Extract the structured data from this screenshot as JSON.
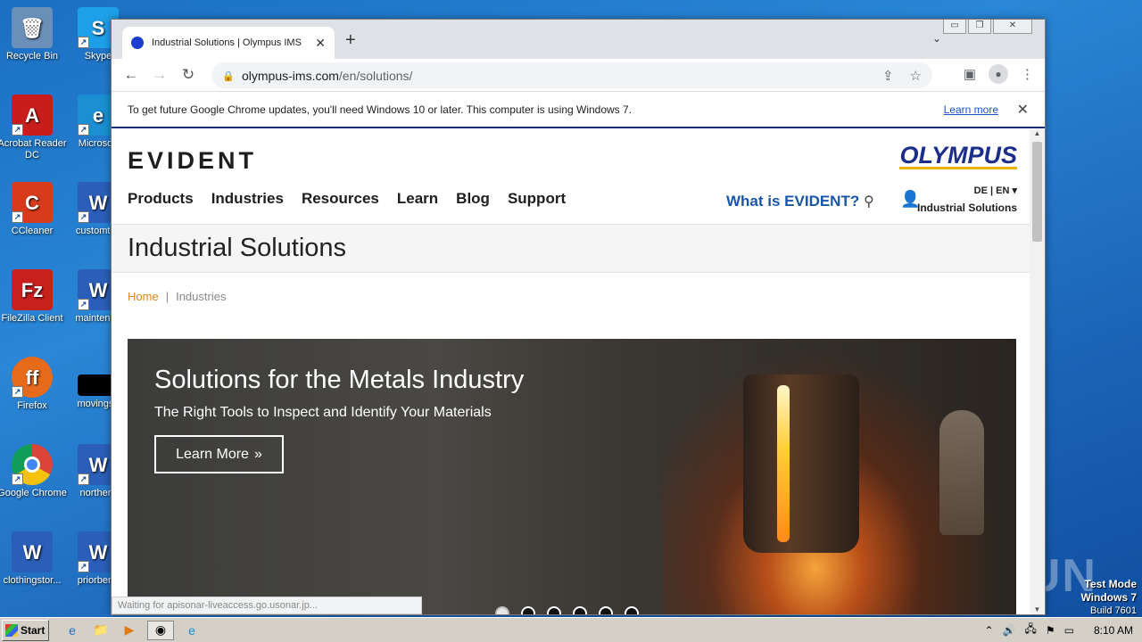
{
  "desktop": {
    "icons": [
      {
        "label": "Recycle Bin",
        "glyph": "🗑",
        "color": "#6a8fb8"
      },
      {
        "label": "Skype",
        "glyph": "S",
        "color": "#1ea0e8"
      },
      {
        "label": "Acrobat Reader DC",
        "glyph": "A",
        "color": "#c91d1d"
      },
      {
        "label": "Microsoft",
        "glyph": "e",
        "color": "#1b8fd1"
      },
      {
        "label": "CCleaner",
        "glyph": "C",
        "color": "#d83b1b"
      },
      {
        "label": "customtes",
        "glyph": "W",
        "color": "#2b5eb8"
      },
      {
        "label": "FileZilla Client",
        "glyph": "Fz",
        "color": "#c8201c"
      },
      {
        "label": "maintenan",
        "glyph": "W",
        "color": "#2b5eb8"
      },
      {
        "label": "Firefox",
        "glyph": "ff",
        "color": "#e66a1a"
      },
      {
        "label": "movingsu",
        "glyph": "",
        "color": "#000000"
      },
      {
        "label": "Google Chrome",
        "glyph": "◉",
        "color": "#2e9b3f"
      },
      {
        "label": "northern",
        "glyph": "W",
        "color": "#2b5eb8"
      },
      {
        "label": "clothingstor...",
        "glyph": "W",
        "color": "#2b5eb8"
      },
      {
        "label": "priorbene",
        "glyph": "W",
        "color": "#2b5eb8"
      }
    ],
    "watermark": "ANY ▷ RUN",
    "test_mode": {
      "line1": "Test Mode",
      "line2": "Windows 7",
      "line3": "Build 7601"
    }
  },
  "browser": {
    "tab_title": "Industrial Solutions | Olympus IMS",
    "tab_close": "✕",
    "new_tab": "+",
    "tab_dropdown": "⌄",
    "window_controls": {
      "minimize": "▭",
      "restore": "❐",
      "close": "✕"
    },
    "url_host": "olympus-ims.com",
    "url_path": "/en/solutions/",
    "info_message": "To get future Google Chrome updates, you'll need Windows 10 or later. This computer is using Windows 7.",
    "info_link": "Learn more",
    "info_close": "✕",
    "status_text": "Waiting for apisonar-liveaccess.go.usonar.jp..."
  },
  "site": {
    "logo_left": "EVIDENT",
    "logo_right": "OLYMPUS",
    "nav": [
      "Products",
      "Industries",
      "Resources",
      "Learn",
      "Blog",
      "Support"
    ],
    "what_link": "What is EVIDENT?",
    "lang_options": "DE  |  EN ▾",
    "segment": "Industrial Solutions",
    "page_title": "Industrial Solutions",
    "breadcrumb": {
      "home": "Home",
      "sep": "|",
      "current": "Industries"
    },
    "hero": {
      "title": "Solutions for the Metals Industry",
      "subtitle": "The Right Tools to Inspect and Identify Your Materials",
      "cta": "Learn More",
      "cta_icon": "»",
      "slide_count": 6,
      "active_slide": 1
    }
  },
  "taskbar": {
    "start_label": "Start",
    "clock": "8:10 AM"
  }
}
